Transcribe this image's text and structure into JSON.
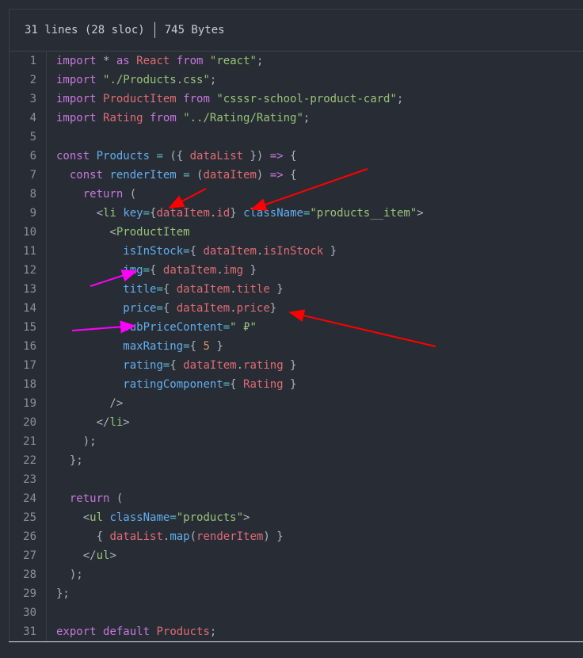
{
  "header": {
    "lines_info": "31 lines (28 sloc)",
    "size_info": "745 Bytes"
  },
  "code_lines": [
    [
      [
        "k",
        "import"
      ],
      [
        "p",
        " * "
      ],
      [
        "k",
        "as"
      ],
      [
        "p",
        " "
      ],
      [
        "r",
        "React"
      ],
      [
        "p",
        " "
      ],
      [
        "k",
        "from"
      ],
      [
        "p",
        " "
      ],
      [
        "s",
        "\"react\""
      ],
      [
        "p",
        ";"
      ]
    ],
    [
      [
        "k",
        "import"
      ],
      [
        "p",
        " "
      ],
      [
        "s",
        "\"./Products.css\""
      ],
      [
        "p",
        ";"
      ]
    ],
    [
      [
        "k",
        "import"
      ],
      [
        "p",
        " "
      ],
      [
        "r",
        "ProductItem"
      ],
      [
        "p",
        " "
      ],
      [
        "k",
        "from"
      ],
      [
        "p",
        " "
      ],
      [
        "s",
        "\"csssr-school-product-card\""
      ],
      [
        "p",
        ";"
      ]
    ],
    [
      [
        "k",
        "import"
      ],
      [
        "p",
        " "
      ],
      [
        "r",
        "Rating"
      ],
      [
        "p",
        " "
      ],
      [
        "k",
        "from"
      ],
      [
        "p",
        " "
      ],
      [
        "s",
        "\"../Rating/Rating\""
      ],
      [
        "p",
        ";"
      ]
    ],
    [],
    [
      [
        "k",
        "const"
      ],
      [
        "p",
        " "
      ],
      [
        "b",
        "Products"
      ],
      [
        "p",
        " "
      ],
      [
        "o",
        "="
      ],
      [
        "p",
        " ({ "
      ],
      [
        "r",
        "dataList"
      ],
      [
        "p",
        " }) "
      ],
      [
        "k",
        "=>"
      ],
      [
        "p",
        " {"
      ]
    ],
    [
      [
        "p",
        "  "
      ],
      [
        "k",
        "const"
      ],
      [
        "p",
        " "
      ],
      [
        "b",
        "renderItem"
      ],
      [
        "p",
        " "
      ],
      [
        "o",
        "="
      ],
      [
        "p",
        " ("
      ],
      [
        "r",
        "dataItem"
      ],
      [
        "p",
        ") "
      ],
      [
        "k",
        "=>"
      ],
      [
        "p",
        " {"
      ]
    ],
    [
      [
        "p",
        "    "
      ],
      [
        "k",
        "return"
      ],
      [
        "p",
        " ("
      ]
    ],
    [
      [
        "p",
        "      <"
      ],
      [
        "g",
        "li"
      ],
      [
        "p",
        " "
      ],
      [
        "b",
        "key"
      ],
      [
        "o",
        "="
      ],
      [
        "p",
        "{"
      ],
      [
        "r",
        "dataItem"
      ],
      [
        "p",
        "."
      ],
      [
        "r",
        "id"
      ],
      [
        "p",
        "} "
      ],
      [
        "b",
        "className"
      ],
      [
        "o",
        "="
      ],
      [
        "s",
        "\"products__item\""
      ],
      [
        "p",
        ">"
      ]
    ],
    [
      [
        "p",
        "        <"
      ],
      [
        "g",
        "ProductItem"
      ]
    ],
    [
      [
        "p",
        "          "
      ],
      [
        "b",
        "isInStock"
      ],
      [
        "o",
        "="
      ],
      [
        "p",
        "{ "
      ],
      [
        "r",
        "dataItem"
      ],
      [
        "p",
        "."
      ],
      [
        "r",
        "isInStock"
      ],
      [
        "p",
        " }"
      ]
    ],
    [
      [
        "p",
        "          "
      ],
      [
        "b",
        "img"
      ],
      [
        "o",
        "="
      ],
      [
        "p",
        "{ "
      ],
      [
        "r",
        "dataItem"
      ],
      [
        "p",
        "."
      ],
      [
        "r",
        "img"
      ],
      [
        "p",
        " }"
      ]
    ],
    [
      [
        "p",
        "          "
      ],
      [
        "b",
        "title"
      ],
      [
        "o",
        "="
      ],
      [
        "p",
        "{ "
      ],
      [
        "r",
        "dataItem"
      ],
      [
        "p",
        "."
      ],
      [
        "r",
        "title"
      ],
      [
        "p",
        " }"
      ]
    ],
    [
      [
        "p",
        "          "
      ],
      [
        "b",
        "price"
      ],
      [
        "o",
        "="
      ],
      [
        "p",
        "{ "
      ],
      [
        "r",
        "dataItem"
      ],
      [
        "p",
        "."
      ],
      [
        "r",
        "price"
      ],
      [
        "p",
        "}"
      ]
    ],
    [
      [
        "p",
        "          "
      ],
      [
        "b",
        "subPriceContent"
      ],
      [
        "o",
        "="
      ],
      [
        "s",
        "\" ₽\""
      ]
    ],
    [
      [
        "p",
        "          "
      ],
      [
        "b",
        "maxRating"
      ],
      [
        "o",
        "="
      ],
      [
        "p",
        "{ "
      ],
      [
        "n",
        "5"
      ],
      [
        "p",
        " }"
      ]
    ],
    [
      [
        "p",
        "          "
      ],
      [
        "b",
        "rating"
      ],
      [
        "o",
        "="
      ],
      [
        "p",
        "{ "
      ],
      [
        "r",
        "dataItem"
      ],
      [
        "p",
        "."
      ],
      [
        "r",
        "rating"
      ],
      [
        "p",
        " }"
      ]
    ],
    [
      [
        "p",
        "          "
      ],
      [
        "b",
        "ratingComponent"
      ],
      [
        "o",
        "="
      ],
      [
        "p",
        "{ "
      ],
      [
        "r",
        "Rating"
      ],
      [
        "p",
        " }"
      ]
    ],
    [
      [
        "p",
        "        />"
      ]
    ],
    [
      [
        "p",
        "      </"
      ],
      [
        "g",
        "li"
      ],
      [
        "p",
        ">"
      ]
    ],
    [
      [
        "p",
        "    );"
      ]
    ],
    [
      [
        "p",
        "  };"
      ]
    ],
    [],
    [
      [
        "p",
        "  "
      ],
      [
        "k",
        "return"
      ],
      [
        "p",
        " ("
      ]
    ],
    [
      [
        "p",
        "    <"
      ],
      [
        "g",
        "ul"
      ],
      [
        "p",
        " "
      ],
      [
        "b",
        "className"
      ],
      [
        "o",
        "="
      ],
      [
        "s",
        "\"products\""
      ],
      [
        "p",
        ">"
      ]
    ],
    [
      [
        "p",
        "      { "
      ],
      [
        "r",
        "dataList"
      ],
      [
        "p",
        "."
      ],
      [
        "b",
        "map"
      ],
      [
        "p",
        "("
      ],
      [
        "r",
        "renderItem"
      ],
      [
        "p",
        ") }"
      ]
    ],
    [
      [
        "p",
        "    </"
      ],
      [
        "g",
        "ul"
      ],
      [
        "p",
        ">"
      ]
    ],
    [
      [
        "p",
        "  );"
      ]
    ],
    [
      [
        "p",
        "};"
      ]
    ],
    [],
    [
      [
        "k",
        "export"
      ],
      [
        "p",
        " "
      ],
      [
        "k",
        "default"
      ],
      [
        "p",
        " "
      ],
      [
        "r",
        "Products"
      ],
      [
        "p",
        ";"
      ]
    ]
  ],
  "annotation_colors": {
    "red": "#ff0000",
    "magenta": "#ff00ff"
  }
}
